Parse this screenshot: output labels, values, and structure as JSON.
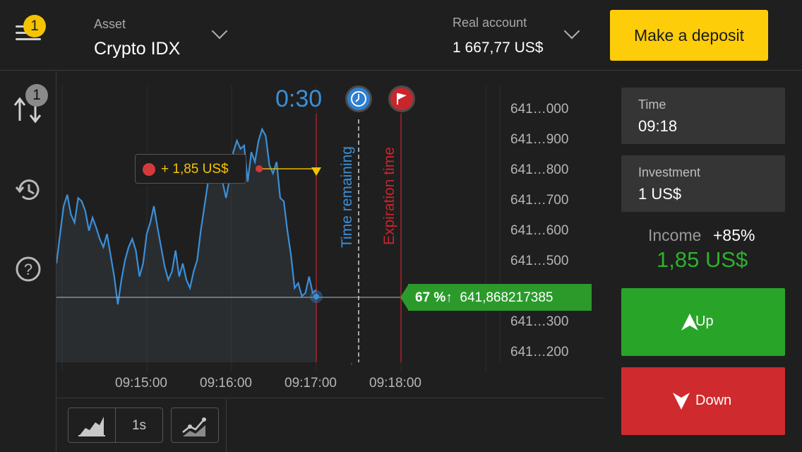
{
  "header": {
    "notification_count": "1",
    "asset_label": "Asset",
    "asset_name": "Crypto IDX",
    "account_label": "Real account",
    "account_balance": "1 667,77 US$",
    "deposit_label": "Make a deposit"
  },
  "sidebar": {
    "trades_count": "1",
    "icons": [
      "menu-icon",
      "trades-icon",
      "history-icon",
      "help-icon"
    ]
  },
  "chart": {
    "timer": "0:30",
    "time_remaining_label": "Time remaining",
    "expiration_label": "Expiration time",
    "profit_label": "+ 1,85 US$",
    "price_tag_pct": "67 %↑",
    "price_tag_value": "641,868217385",
    "y_ticks": [
      "641…000",
      "641…900",
      "641…800",
      "641…700",
      "641…600",
      "641…500",
      "641…300",
      "641…200"
    ],
    "x_ticks": [
      "09:15:00",
      "09:16:00",
      "09:17:00",
      "09:18:00"
    ]
  },
  "chart_data": {
    "type": "line",
    "series": [
      {
        "values": [
          0.2,
          0.38,
          0.55,
          0.62,
          0.5,
          0.45,
          0.6,
          0.58,
          0.52,
          0.4,
          0.48,
          0.42,
          0.35,
          0.3,
          0.38,
          0.25,
          0.12,
          -0.05,
          0.1,
          0.22,
          0.3,
          0.35,
          0.28,
          0.12,
          0.2,
          0.38,
          0.45,
          0.55,
          0.42,
          0.3,
          0.18,
          0.1,
          0.15,
          0.28,
          0.12,
          0.2,
          0.1,
          0.05,
          0.15,
          0.22,
          0.4,
          0.55,
          0.7,
          0.78,
          0.85,
          0.8,
          0.7,
          0.6,
          0.72,
          0.88,
          0.95,
          0.9,
          0.92,
          0.7,
          0.88,
          0.82,
          0.95,
          1.02,
          0.98,
          0.8,
          0.75,
          0.82,
          0.6,
          0.58,
          0.4,
          0.25,
          0.05,
          0.08,
          0.0,
          0.02,
          0.12,
          0.02,
          0.04
        ]
      }
    ],
    "ylim": [
      641.15,
      642.05
    ],
    "x_ticks": [
      "09:15:00",
      "09:16:00",
      "09:17:00",
      "09:18:00"
    ],
    "y_ticks": [
      "641…000",
      "641…900",
      "641…800",
      "641…700",
      "641…600",
      "641…500",
      "641…300",
      "641…200"
    ],
    "current_price": "641,868217385",
    "grid": true
  },
  "toolbar": {
    "interval": "1s"
  },
  "panel": {
    "time_label": "Time",
    "time_value": "09:18",
    "investment_label": "Investment",
    "investment_value": "1 US$",
    "income_label": "Income",
    "income_pct": "+85%",
    "income_value": "1,85 US$",
    "up_label": "Up",
    "down_label": "Down"
  },
  "colors": {
    "accent_yellow": "#fecd0a",
    "up_green": "#28a428",
    "down_red": "#cf2a2e",
    "line_blue": "#3b8fd8"
  }
}
